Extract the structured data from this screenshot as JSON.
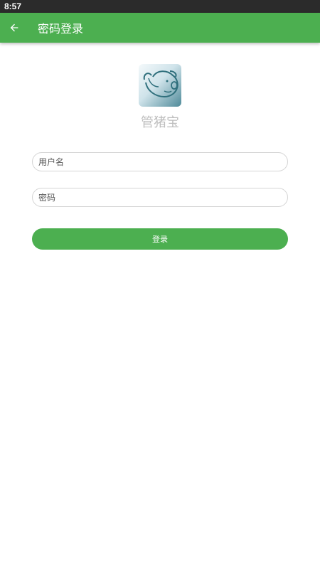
{
  "status_bar": {
    "time": "8:57"
  },
  "app_bar": {
    "back_icon": "arrow-left-icon",
    "title": "密码登录"
  },
  "logo": {
    "icon": "pig-logo-icon",
    "app_name": "管猪宝"
  },
  "form": {
    "username": {
      "placeholder": "用户名",
      "value": ""
    },
    "password": {
      "placeholder": "密码",
      "value": ""
    },
    "login_label": "登录"
  },
  "colors": {
    "primary": "#4caf50",
    "status_bar": "#2b2b2b",
    "app_name_text": "#bdbdbd"
  }
}
